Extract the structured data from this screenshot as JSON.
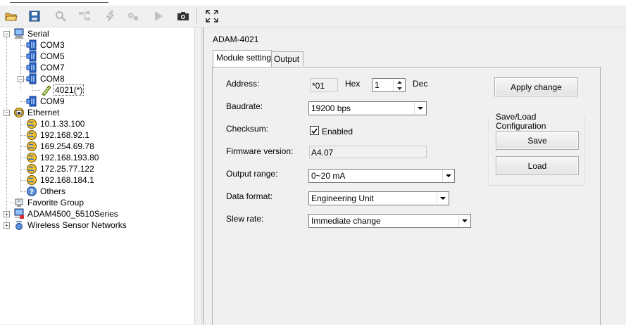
{
  "toolbar": {
    "buttons": [
      {
        "icon": "open-folder-icon",
        "enabled": true
      },
      {
        "icon": "save-disk-icon",
        "enabled": true
      },
      {
        "icon": "search-icon",
        "enabled": false
      },
      {
        "icon": "network-icon",
        "enabled": false
      },
      {
        "icon": "lightning-icon",
        "enabled": false
      },
      {
        "icon": "gears-icon",
        "enabled": false
      },
      {
        "icon": "play-icon",
        "enabled": false
      },
      {
        "icon": "camera-icon",
        "enabled": true
      },
      {
        "icon": "fullscreen-icon",
        "enabled": true
      }
    ]
  },
  "tree": {
    "serial": "Serial",
    "com3": "COM3",
    "com5": "COM5",
    "com7": "COM7",
    "com8": "COM8",
    "module": "4021(*)",
    "com9": "COM9",
    "ethernet": "Ethernet",
    "ip1": "10.1.33.100",
    "ip2": "192.168.92.1",
    "ip3": "169.254.69.78",
    "ip4": "192.168.193.80",
    "ip5": "172.25.77.122",
    "ip6": "192.168.184.1",
    "others": "Others",
    "favorite": "Favorite Group",
    "adam4500": "ADAM4500_5510Series",
    "wsn": "Wireless Sensor Networks"
  },
  "panel": {
    "title": "ADAM-4021",
    "tabs": {
      "module_setting": "Module setting",
      "output": "Output"
    },
    "form": {
      "address_label": "Address:",
      "address_hex": "*01",
      "hex_label": "Hex",
      "address_dec": "1",
      "dec_label": "Dec",
      "baudrate_label": "Baudrate:",
      "baudrate_value": "19200 bps",
      "checksum_label": "Checksum:",
      "checksum_text": "Enabled",
      "checksum_checked": true,
      "firmware_label": "Firmware version:",
      "firmware_value": "A4.07",
      "output_range_label": "Output range:",
      "output_range_value": "0~20 mA",
      "data_format_label": "Data format:",
      "data_format_value": "Engineering Unit",
      "slew_rate_label": "Slew rate:",
      "slew_rate_value": "Immediate change"
    },
    "apply_button": "Apply change",
    "save_load": {
      "title": "Save/Load Configuration",
      "save_button": "Save",
      "load_button": "Load"
    }
  }
}
